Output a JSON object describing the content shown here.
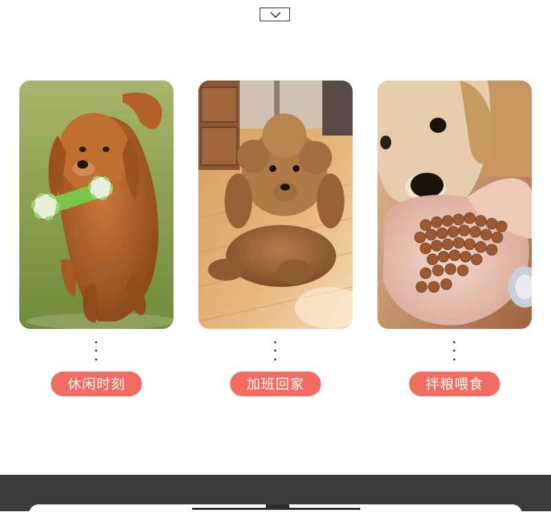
{
  "header": {
    "toggle_icon": "chevron-down-icon"
  },
  "cards": [
    {
      "label": "休闲时刻",
      "photo": "golden-retriever-running-with-toy"
    },
    {
      "label": "加班回家",
      "photo": "brown-poodle-lying-on-floor"
    },
    {
      "label": "拌粮喂食",
      "photo": "dog-sniffing-kibble-in-hand"
    }
  ],
  "colors": {
    "pill": "#f26b61",
    "footer_band": "#3b3b3b",
    "background": "#ffffff"
  }
}
